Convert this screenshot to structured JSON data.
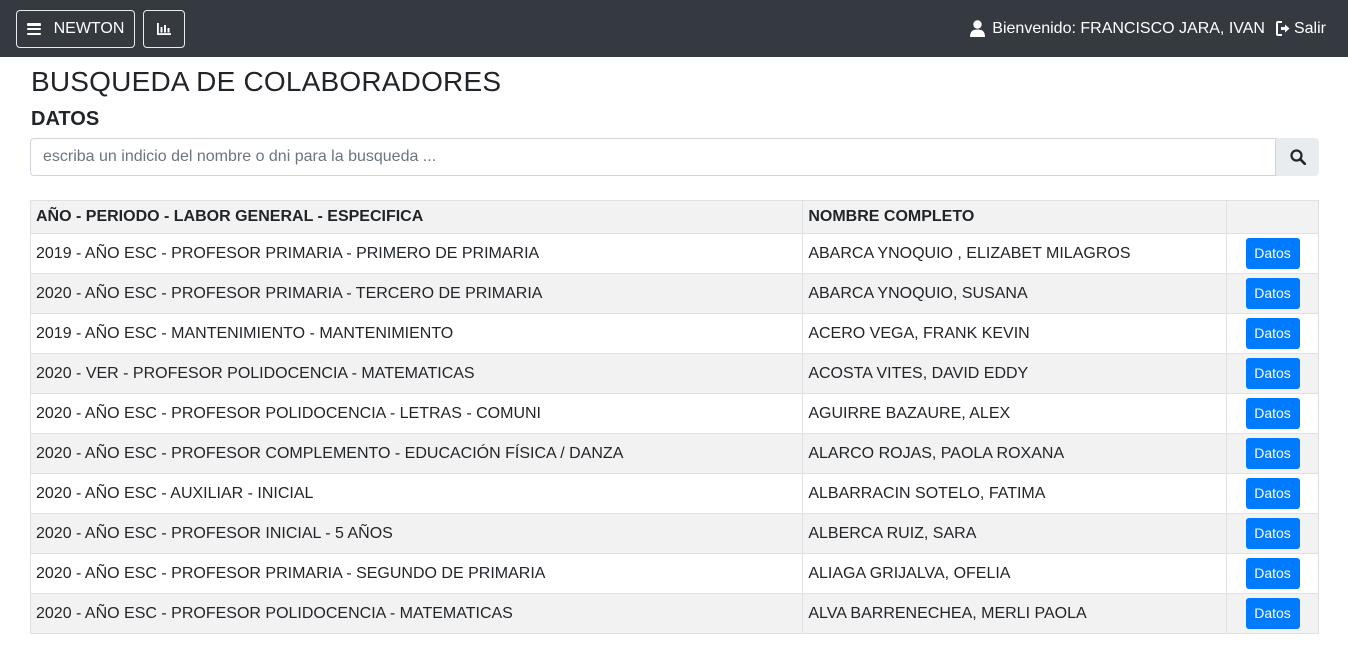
{
  "navbar": {
    "menu_label": "NEWTON",
    "menu_icon": "hamburger-icon",
    "chart_icon": "bar-chart-icon",
    "user_icon": "user-icon",
    "welcome_text": "Bienvenido: FRANCISCO JARA, IVAN",
    "logout_icon": "sign-out-icon",
    "logout_label": "Salir",
    "background": "#343a40"
  },
  "page": {
    "title": "BUSQUEDA DE COLABORADORES",
    "section": "DATOS"
  },
  "search": {
    "placeholder": "escriba un indicio del nombre o dni para la busqueda ...",
    "value": "",
    "icon": "search-icon"
  },
  "table": {
    "headers": [
      "AÑO - PERIODO - LABOR GENERAL - ESPECIFICA",
      "NOMBRE COMPLETO",
      ""
    ],
    "rows": [
      {
        "labor": "2019 - AÑO ESC - PROFESOR PRIMARIA - PRIMERO DE PRIMARIA",
        "nombre": "ABARCA YNOQUIO , ELIZABET MILAGROS",
        "action": "Datos"
      },
      {
        "labor": "2020 - AÑO ESC - PROFESOR PRIMARIA - TERCERO DE PRIMARIA",
        "nombre": "ABARCA YNOQUIO, SUSANA",
        "action": "Datos"
      },
      {
        "labor": "2019 - AÑO ESC - MANTENIMIENTO - MANTENIMIENTO",
        "nombre": "ACERO VEGA, FRANK KEVIN",
        "action": "Datos"
      },
      {
        "labor": "2020 - VER - PROFESOR POLIDOCENCIA - MATEMATICAS",
        "nombre": "ACOSTA VITES, DAVID EDDY",
        "action": "Datos"
      },
      {
        "labor": "2020 - AÑO ESC - PROFESOR POLIDOCENCIA - LETRAS - COMUNI",
        "nombre": "AGUIRRE BAZAURE, ALEX",
        "action": "Datos"
      },
      {
        "labor": "2020 - AÑO ESC - PROFESOR COMPLEMENTO - EDUCACIÓN FÍSICA / DANZA",
        "nombre": "ALARCO ROJAS, PAOLA ROXANA",
        "action": "Datos"
      },
      {
        "labor": "2020 - AÑO ESC - AUXILIAR - INICIAL",
        "nombre": "ALBARRACIN SOTELO, FATIMA",
        "action": "Datos"
      },
      {
        "labor": "2020 - AÑO ESC - PROFESOR INICIAL - 5 AÑOS",
        "nombre": "ALBERCA RUIZ, SARA",
        "action": "Datos"
      },
      {
        "labor": "2020 - AÑO ESC - PROFESOR PRIMARIA - SEGUNDO  DE PRIMARIA",
        "nombre": "ALIAGA GRIJALVA, OFELIA",
        "action": "Datos"
      },
      {
        "labor": "2020 - AÑO ESC - PROFESOR POLIDOCENCIA - MATEMATICAS",
        "nombre": "ALVA BARRENECHEA, MERLI PAOLA",
        "action": "Datos"
      }
    ]
  },
  "colors": {
    "primary_button": "#007bff",
    "striped_row": "#f2f2f2"
  }
}
